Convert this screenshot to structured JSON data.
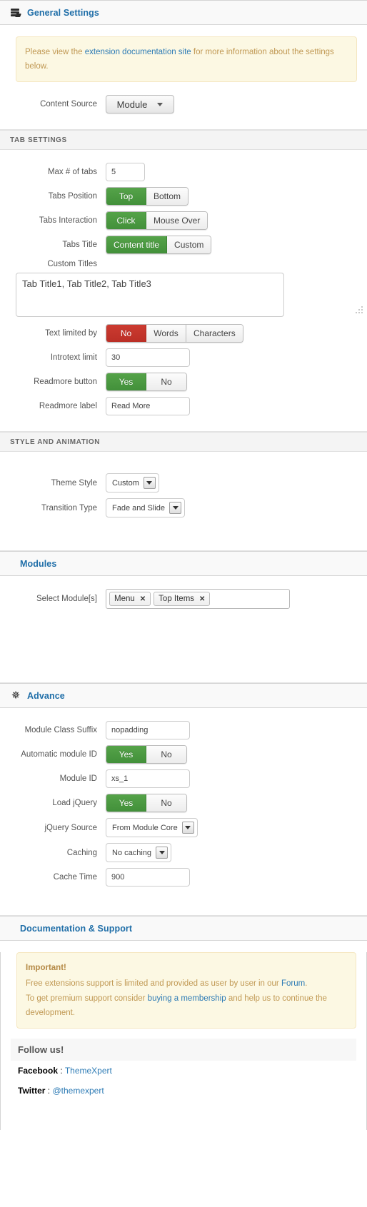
{
  "general": {
    "title": "General Settings",
    "icon": "stack-icon",
    "notice": {
      "before": "Please view the ",
      "link": "extension documentation site",
      "after": " for more information about the settings below."
    },
    "content_source": {
      "label": "Content Source",
      "value": "Module"
    }
  },
  "tab_settings": {
    "heading": "TAB SETTINGS",
    "max_tabs": {
      "label": "Max # of tabs",
      "value": "5"
    },
    "tabs_position": {
      "label": "Tabs Position",
      "options": [
        "Top",
        "Bottom"
      ],
      "selected": "Top",
      "accent": "#4a9c3f"
    },
    "tabs_interaction": {
      "label": "Tabs Interaction",
      "options": [
        "Click",
        "Mouse Over"
      ],
      "selected": "Click",
      "accent": "#4a9c3f"
    },
    "tabs_title": {
      "label": "Tabs Title",
      "options": [
        "Content title",
        "Custom"
      ],
      "selected": "Content title",
      "accent": "#4a9c3f"
    },
    "custom_titles": {
      "label": "Custom Titles",
      "value": "Tab Title1, Tab Title2, Tab Title3"
    },
    "text_limited_by": {
      "label": "Text limited by",
      "options": [
        "No",
        "Words",
        "Characters"
      ],
      "selected": "No",
      "accent": "#c3352b"
    },
    "introtext_limit": {
      "label": "Introtext limit",
      "value": "30"
    },
    "readmore_button": {
      "label": "Readmore button",
      "options": [
        "Yes",
        "No"
      ],
      "selected": "Yes",
      "accent": "#4a9c3f"
    },
    "readmore_label": {
      "label": "Readmore label",
      "value": "Read More"
    }
  },
  "style_animation": {
    "heading": "STYLE AND ANIMATION",
    "theme_style": {
      "label": "Theme Style",
      "value": "Custom"
    },
    "transition_type": {
      "label": "Transition Type",
      "value": "Fade and Slide"
    }
  },
  "modules": {
    "title": "Modules",
    "select_modules": {
      "label": "Select Module[s]",
      "chips": [
        "Menu",
        "Top Items"
      ],
      "close_glyph": "✕"
    }
  },
  "advance": {
    "title": "Advance",
    "icon": "gear-icon",
    "module_class_suffix": {
      "label": "Module Class Suffix",
      "value": "nopadding"
    },
    "automatic_module_id": {
      "label": "Automatic module ID",
      "options": [
        "Yes",
        "No"
      ],
      "selected": "Yes",
      "accent": "#4a9c3f"
    },
    "module_id": {
      "label": "Module ID",
      "value": "xs_1"
    },
    "load_jquery": {
      "label": "Load jQuery",
      "options": [
        "Yes",
        "No"
      ],
      "selected": "Yes",
      "accent": "#4a9c3f"
    },
    "jquery_source": {
      "label": "jQuery Source",
      "value": "From Module Core"
    },
    "caching": {
      "label": "Caching",
      "value": "No caching"
    },
    "cache_time": {
      "label": "Cache Time",
      "value": "900"
    }
  },
  "documentation": {
    "title": "Documentation & Support",
    "important_heading": "Important!",
    "line1_before": "Free extensions support is limited and provided as user by user in our ",
    "line1_link": "Forum",
    "line1_after": ".",
    "line2_before": "To get premium support consider ",
    "line2_link": "buying a membership",
    "line2_after": " and help us to continue the development.",
    "follow_heading": "Follow us!",
    "facebook_label": "Facebook",
    "facebook_sep": " : ",
    "facebook_value": "ThemeXpert",
    "twitter_label": "Twitter",
    "twitter_sep": " : ",
    "twitter_value": "@themexpert"
  }
}
